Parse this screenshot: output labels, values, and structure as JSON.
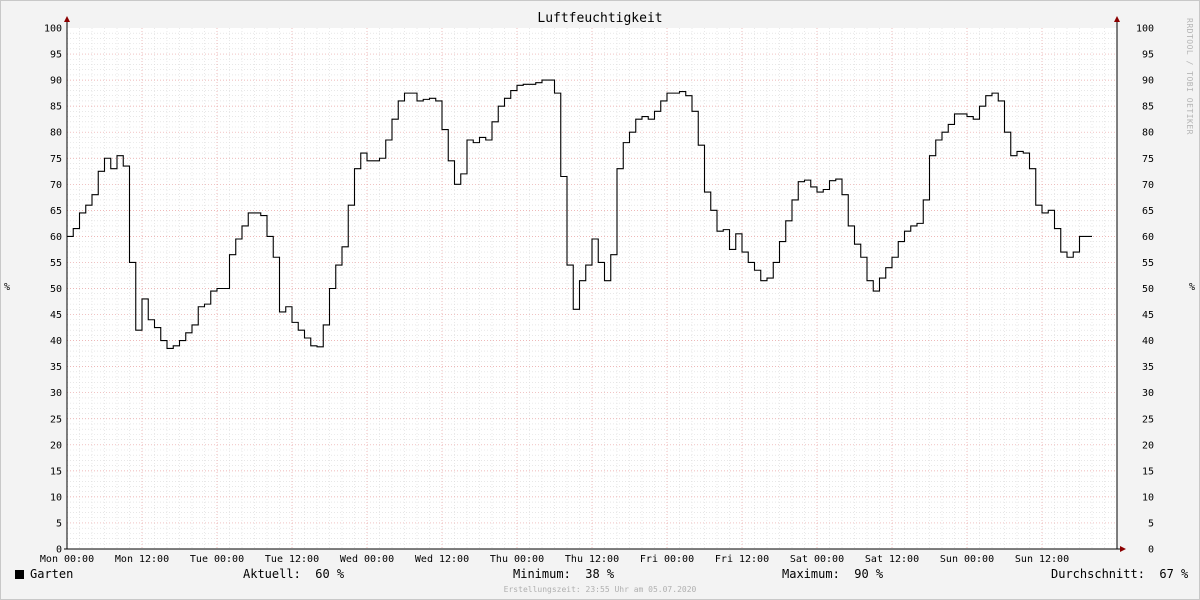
{
  "colors": {
    "background": "#f3f3f3",
    "plot_background": "#ffffff",
    "grid_minor": "#d9d9d9",
    "grid_major": "#e8a0a0",
    "line": "#000000",
    "axis_arrow": "#8b0000"
  },
  "chart_data": {
    "type": "line",
    "title": "Luftfeuchtigkeit",
    "ylabel": "%",
    "ylim": [
      0,
      100
    ],
    "yticks": [
      0,
      5,
      10,
      15,
      20,
      25,
      30,
      35,
      40,
      45,
      50,
      55,
      60,
      65,
      70,
      75,
      80,
      85,
      90,
      95,
      100
    ],
    "xlim_hours": [
      0,
      168
    ],
    "xtick_labels": [
      "Mon 00:00",
      "Mon 12:00",
      "Tue 00:00",
      "Tue 12:00",
      "Wed 00:00",
      "Wed 12:00",
      "Thu 00:00",
      "Thu 12:00",
      "Fri 00:00",
      "Fri 12:00",
      "Sat 00:00",
      "Sat 12:00",
      "Sun 00:00",
      "Sun 12:00"
    ],
    "grid": true,
    "step": true,
    "series": [
      {
        "name": "Garten",
        "color": "#000000",
        "x": [
          0,
          1,
          2,
          3,
          4,
          5,
          6,
          7,
          8,
          9,
          10,
          11,
          12,
          13,
          14,
          15,
          16,
          17,
          18,
          19,
          20,
          21,
          22,
          23,
          24,
          25,
          26,
          27,
          28,
          29,
          30,
          31,
          32,
          33,
          34,
          35,
          36,
          37,
          38,
          39,
          40,
          41,
          42,
          43,
          44,
          45,
          46,
          47,
          48,
          49,
          50,
          51,
          52,
          53,
          54,
          55,
          56,
          57,
          58,
          59,
          60,
          61,
          62,
          63,
          64,
          65,
          66,
          67,
          68,
          69,
          70,
          71,
          72,
          73,
          74,
          75,
          76,
          77,
          78,
          79,
          80,
          81,
          82,
          83,
          84,
          85,
          86,
          87,
          88,
          89,
          90,
          91,
          92,
          93,
          94,
          95,
          96,
          97,
          98,
          99,
          100,
          101,
          102,
          103,
          104,
          105,
          106,
          107,
          108,
          109,
          110,
          111,
          112,
          113,
          114,
          115,
          116,
          117,
          118,
          119,
          120,
          121,
          122,
          123,
          124,
          125,
          126,
          127,
          128,
          129,
          130,
          131,
          132,
          133,
          134,
          135,
          136,
          137,
          138,
          139,
          140,
          141,
          142,
          143,
          144,
          145,
          146,
          147,
          148,
          149,
          150,
          151,
          152,
          153,
          154,
          155,
          156,
          157,
          158,
          159,
          160,
          161,
          162,
          163
        ],
        "values": [
          60,
          61.5,
          64.5,
          66,
          68,
          72.5,
          75,
          73,
          75.5,
          73.5,
          55,
          42,
          48,
          44,
          42.5,
          40,
          38.5,
          39,
          40,
          41.5,
          43,
          46.5,
          47,
          49.5,
          50,
          50,
          56.5,
          59.5,
          62,
          64.5,
          64.5,
          64,
          60,
          56,
          45.5,
          46.5,
          43.5,
          42,
          40.5,
          39,
          38.8,
          43,
          50,
          54.5,
          58,
          66,
          73,
          76,
          74.5,
          74.5,
          75,
          78.5,
          82.5,
          86,
          87.5,
          87.5,
          86,
          86.3,
          86.5,
          86,
          80.5,
          74.5,
          70,
          72,
          78.5,
          78,
          79,
          78.5,
          82,
          85,
          86.5,
          88,
          89,
          89.2,
          89.2,
          89.5,
          90,
          90,
          87.5,
          71.5,
          54.5,
          46,
          51.5,
          54.5,
          59.5,
          55,
          51.5,
          56.5,
          73,
          78,
          80,
          82.5,
          83,
          82.5,
          84,
          86,
          87.5,
          87.5,
          87.8,
          87,
          84,
          77.5,
          68.5,
          65,
          61,
          61.3,
          57.5,
          60.5,
          57,
          55,
          53.5,
          51.5,
          52,
          55,
          59,
          63,
          67,
          70.5,
          70.8,
          69.5,
          68.5,
          69,
          70.7,
          71,
          68,
          62,
          58.5,
          56,
          51.5,
          49.5,
          52,
          54,
          56,
          59,
          61,
          62,
          62.5,
          67,
          75.5,
          78.5,
          80,
          81.5,
          83.5,
          83.5,
          83,
          82.5,
          85,
          87,
          87.5,
          86,
          80,
          75.5,
          76.3,
          76,
          73,
          66,
          64.5,
          65,
          61.5,
          57,
          56,
          57,
          60,
          60
        ]
      }
    ]
  },
  "legend": {
    "series_name": "Garten",
    "current_label": "Aktuell:",
    "current_value": "60 %",
    "min_label": "Minimum:",
    "min_value": "38 %",
    "max_label": "Maximum:",
    "max_value": "90 %",
    "avg_label": "Durchschnitt:",
    "avg_value": "67 %"
  },
  "footer_text": "Erstellungszeit: 23:55 Uhr am 05.07.2020",
  "watermark_text": "RRDTOOL / TOBI OETIKER"
}
